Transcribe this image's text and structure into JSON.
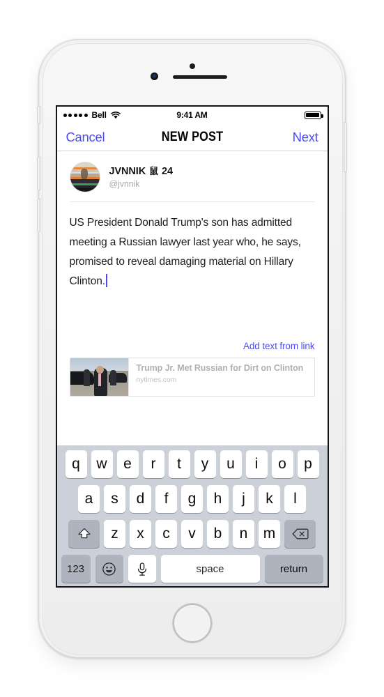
{
  "device": {
    "name": "iphone-white",
    "sensors": [
      "proximity-sensor",
      "front-camera",
      "earpiece-speaker"
    ],
    "buttons": [
      "mute-switch",
      "volume-up",
      "volume-down",
      "power-button",
      "home-button"
    ]
  },
  "status_bar": {
    "signal_dots": 5,
    "carrier": "Bell",
    "wifi": "wifi-icon",
    "time": "9:41 AM",
    "battery": "battery-full-icon"
  },
  "nav": {
    "cancel_label": "Cancel",
    "title": "NEW POST",
    "next_label": "Next",
    "accent_color": "#4b4bf5"
  },
  "profile": {
    "avatar": "user-avatar",
    "name": "JVNNIK",
    "badge_glyph": "鼠",
    "badge_number": "24",
    "handle": "@jvnnik"
  },
  "post": {
    "text": "US President Donald Trump's son has admitted meeting a Russian lawyer last year who, he says, promised to reveal damaging material on Hillary Clinton.",
    "caret_visible": true
  },
  "link_section": {
    "add_text_label": "Add text from link",
    "card": {
      "thumbnail": "trump-jr-tarmac-photo",
      "title": "Trump Jr. Met Russian for Dirt on Clinton",
      "source": "nytimes.com"
    }
  },
  "keyboard": {
    "row1": [
      "q",
      "w",
      "e",
      "r",
      "t",
      "y",
      "u",
      "i",
      "o",
      "p"
    ],
    "row2": [
      "a",
      "s",
      "d",
      "f",
      "g",
      "h",
      "j",
      "k",
      "l"
    ],
    "row3": [
      "z",
      "x",
      "c",
      "v",
      "b",
      "n",
      "m"
    ],
    "shift_icon": "shift-icon",
    "backspace_icon": "backspace-icon",
    "numbers_label": "123",
    "emoji_icon": "emoji-icon",
    "mic_icon": "microphone-icon",
    "space_label": "space",
    "return_label": "return",
    "background_color": "#ccd1d9",
    "key_color": "#ffffff",
    "modifier_key_color": "#aeb3bd"
  }
}
